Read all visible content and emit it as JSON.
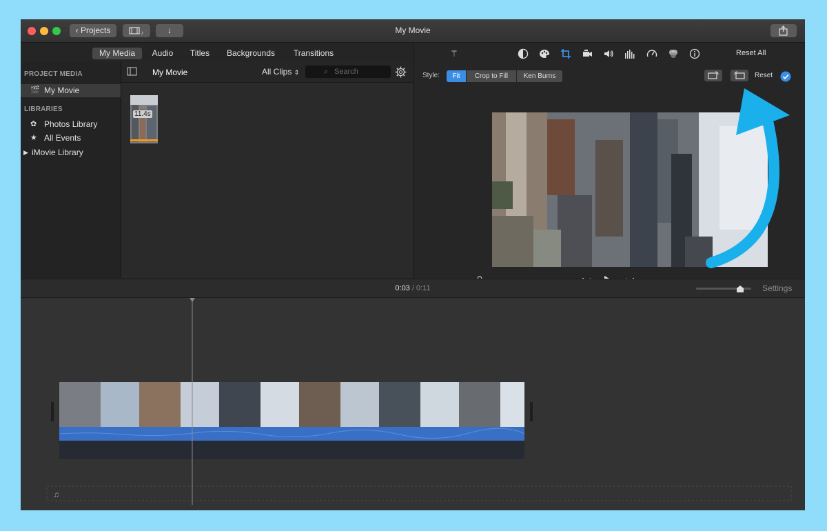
{
  "window": {
    "title": "My Movie",
    "projects_button": "Projects"
  },
  "tabs": [
    "My Media",
    "Audio",
    "Titles",
    "Backgrounds",
    "Transitions"
  ],
  "sidebar": {
    "project_media_header": "PROJECT MEDIA",
    "project_item": "My Movie",
    "libraries_header": "LIBRARIES",
    "libraries": [
      "Photos Library",
      "All Events",
      "iMovie Library"
    ]
  },
  "browser": {
    "title": "My Movie",
    "filter": "All Clips",
    "search_placeholder": "Search",
    "clip_duration": "11.4s"
  },
  "viewer": {
    "reset_all": "Reset All",
    "style_label": "Style:",
    "style_options": [
      "Fit",
      "Crop to Fill",
      "Ken Burns"
    ],
    "selected_style": "Fit",
    "reset": "Reset"
  },
  "timeline": {
    "current_time": "0:03",
    "separator": "/",
    "total_time": "0:11",
    "settings": "Settings",
    "zoom_level": 0.8
  },
  "colors": {
    "accent_blue": "#3a8ee6",
    "arrow": "#1ab0ec",
    "audio_wave": "#3a6fc6"
  },
  "icons": [
    "back-chevron-icon",
    "media-library-icon",
    "import-arrow-icon",
    "share-icon",
    "magic-wand-icon",
    "color-balance-icon",
    "color-palette-icon",
    "crop-icon",
    "stabilization-camera-icon",
    "volume-icon",
    "equalizer-icon",
    "speed-gauge-icon",
    "filter-icon",
    "info-icon",
    "rotate-left-icon",
    "rotate-right-icon",
    "checkmark-icon",
    "microphone-icon",
    "skip-back-icon",
    "play-icon",
    "skip-forward-icon",
    "fullscreen-icon",
    "gear-icon",
    "search-icon",
    "music-note-icon",
    "sidebar-toggle-icon"
  ]
}
